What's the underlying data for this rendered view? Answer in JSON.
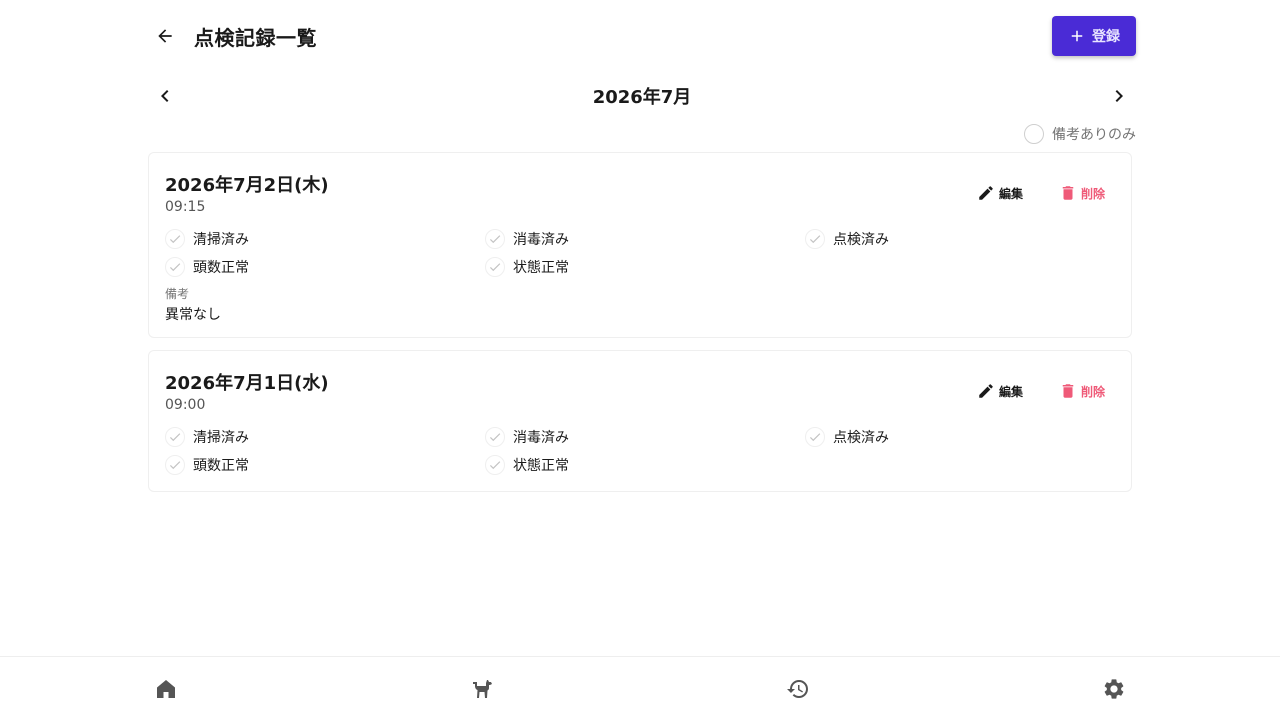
{
  "header": {
    "title": "点検記録一覧",
    "register_label": "登録"
  },
  "month_nav": {
    "label": "2026年7月"
  },
  "filter": {
    "label": "備考ありのみ",
    "checked": false
  },
  "records": [
    {
      "date": "2026年7月2日(木)",
      "time": "09:15",
      "edit_label": "編集",
      "delete_label": "削除",
      "checks": [
        "清掃済み",
        "消毒済み",
        "点検済み",
        "頭数正常",
        "状態正常"
      ],
      "note_label": "備考",
      "note": "異常なし"
    },
    {
      "date": "2026年7月1日(水)",
      "time": "09:00",
      "edit_label": "編集",
      "delete_label": "削除",
      "checks": [
        "清掃済み",
        "消毒済み",
        "点検済み",
        "頭数正常",
        "状態正常"
      ]
    }
  ],
  "bottom_nav": {
    "items": [
      "home-icon",
      "dog-icon",
      "history-icon",
      "settings-icon"
    ]
  },
  "colors": {
    "primary": "#4a2bd6",
    "delete": "#ef5a78",
    "icon": "#555555"
  }
}
